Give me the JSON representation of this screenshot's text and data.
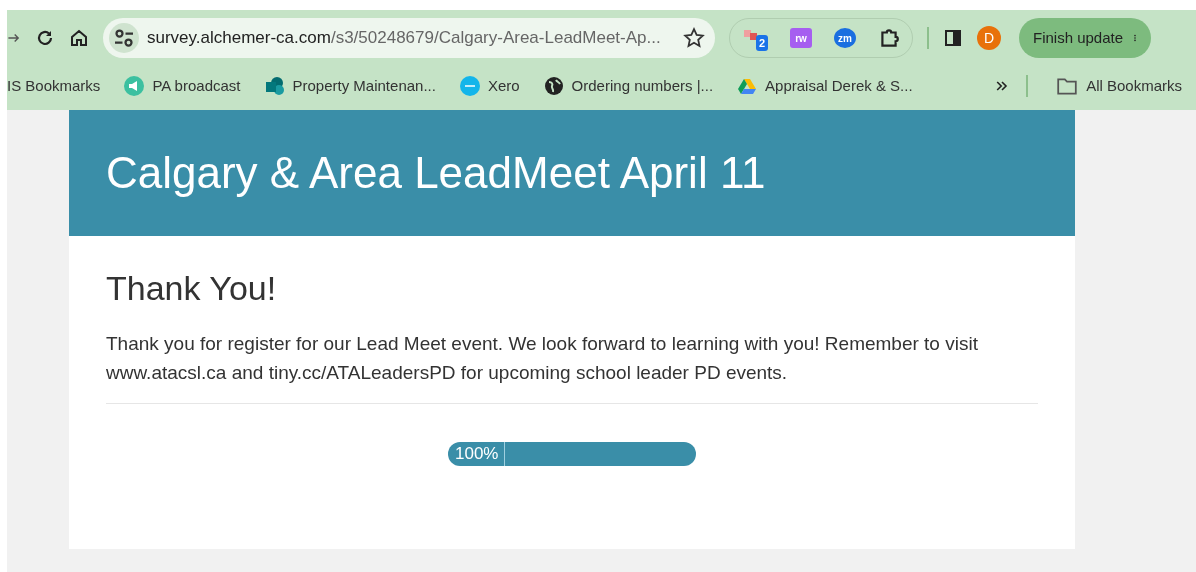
{
  "browser": {
    "url_host": "survey.alchemer-ca.com",
    "url_path": "/s3/50248679/Calgary-Area-LeadMeet-Ap...",
    "extensions": [
      {
        "kind": "badge",
        "label": "2"
      },
      {
        "kind": "rw",
        "label": "rw"
      },
      {
        "kind": "zm",
        "label": "zm"
      },
      {
        "kind": "puzzle"
      }
    ],
    "profile": "D",
    "update_button": "Finish update"
  },
  "bookmarks": [
    {
      "kind": "plain",
      "label": "IS Bookmarks"
    },
    {
      "kind": "megaphone",
      "label": "PA broadcast"
    },
    {
      "kind": "sharepoint",
      "label": "Property Maintenan..."
    },
    {
      "kind": "xero",
      "label": "Xero"
    },
    {
      "kind": "globe",
      "label": "Ordering numbers |..."
    },
    {
      "kind": "drive",
      "label": "Appraisal Derek & S..."
    }
  ],
  "all_bookmarks": "All Bookmarks",
  "survey": {
    "title": "Calgary & Area LeadMeet April 11",
    "heading": "Thank You!",
    "message": "Thank you for register for our Lead Meet event.  We look forward to learning with you!  Remember to visit www.atacsl.ca and tiny.cc/ATALeadersPD for upcoming school leader PD events.",
    "progress": {
      "reading": "100%"
    }
  }
}
